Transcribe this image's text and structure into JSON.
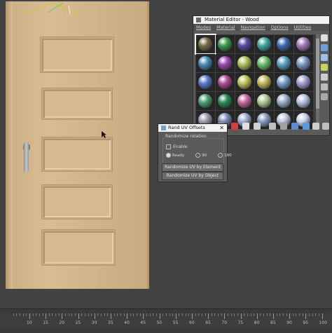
{
  "material_editor": {
    "title": "Material Editor - Wood",
    "menu": [
      "Modes",
      "Material",
      "Navigation",
      "Options",
      "Utilities"
    ],
    "slot_colors": [
      "#7a6a4a",
      "#3f9a52",
      "#5a4aa0",
      "#3fa7a0",
      "#3f6ab0",
      "#a07ab8",
      "#4a8aba",
      "#9a4ab0",
      "#b0c05a",
      "#6ac06a",
      "#5aa0c0",
      "#7a9ac0",
      "#5a7ac8",
      "#b04a90",
      "#c0c05a",
      "#c0b85a",
      "#7aa0c8",
      "#a0a0d0",
      "#4aa070",
      "#2a8a5a",
      "#c86aa0",
      "#b0c89a",
      "#9ab0c8",
      "#b8c0e0",
      "#9a9aaa",
      "#7a8ab0",
      "#a0aad0",
      "#8a9ac0",
      "#c0c8e0",
      "#d0d0e8"
    ]
  },
  "rand_uv": {
    "title": "Rand UV Offsets",
    "group_label": "Randomize rotation",
    "enable_label": "Enable",
    "radio_labels": [
      "Ready",
      "90",
      "180"
    ],
    "btn_element": "Randomize UV by Element",
    "btn_object": "Randomize UV by Object"
  },
  "timeline": {
    "labels": [
      "10",
      "15",
      "20",
      "25",
      "30",
      "35",
      "40",
      "45",
      "50",
      "55",
      "60",
      "65",
      "70",
      "75",
      "80",
      "85",
      "90",
      "95",
      "100"
    ]
  },
  "icons": {
    "cursor": "arrow-cursor-icon",
    "gizmo": "transform-gizmo-icon"
  }
}
